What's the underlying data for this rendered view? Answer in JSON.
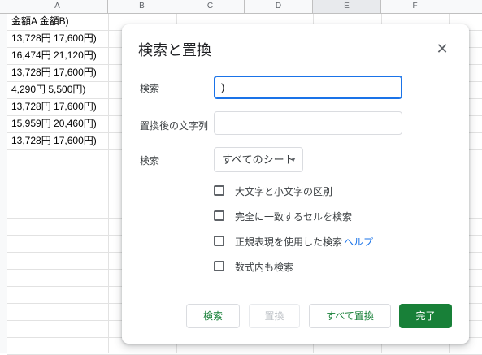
{
  "sheet": {
    "columns": [
      "A",
      "B",
      "C",
      "D",
      "E",
      "F"
    ],
    "selected_column": "E",
    "cells_a": [
      "金額A 金額B)",
      "13,728円 17,600円)",
      "16,474円 21,120円)",
      "13,728円 17,600円)",
      "4,290円 5,500円)",
      "13,728円 17,600円)",
      "15,959円 20,460円)",
      "13,728円 17,600円)"
    ]
  },
  "dialog": {
    "title": "検索と置換",
    "close_icon": "close-icon",
    "find_label": "検索",
    "find_value": ")",
    "replace_label": "置換後の文字列",
    "replace_value": "",
    "scope_label": "検索",
    "scope_value": "すべてのシート",
    "options": {
      "match_case": "大文字と小文字の区別",
      "entire_cell": "完全に一致するセルを検索",
      "regex": "正規表現を使用した検索",
      "help": "ヘルプ",
      "formulas": "数式内も検索"
    },
    "buttons": {
      "find": "検索",
      "replace": "置換",
      "replace_all": "すべて置換",
      "done": "完了"
    },
    "colors": {
      "accent_green": "#188038",
      "focus_blue": "#1a73e8"
    }
  }
}
